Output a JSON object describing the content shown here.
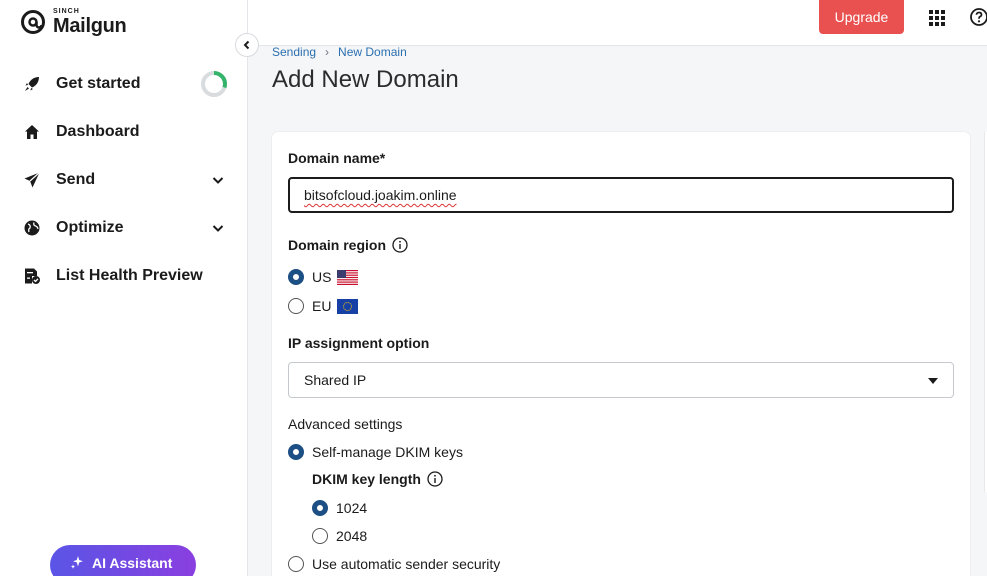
{
  "brand": {
    "small": "SINCH",
    "name": "Mailgun"
  },
  "sidebar": {
    "items": [
      {
        "label": "Get started",
        "icon": "rocket-icon"
      },
      {
        "label": "Dashboard",
        "icon": "home-icon"
      },
      {
        "label": "Send",
        "icon": "paper-plane-icon"
      },
      {
        "label": "Optimize",
        "icon": "globe-icon"
      },
      {
        "label": "List Health Preview",
        "icon": "list-check-icon"
      }
    ],
    "ai_button": "AI Assistant",
    "get_started_progress": 0.3
  },
  "topbar": {
    "upgrade": "Upgrade"
  },
  "breadcrumb": {
    "parent": "Sending",
    "current": "New Domain"
  },
  "page": {
    "title": "Add New Domain"
  },
  "form": {
    "domain_label": "Domain name*",
    "domain_value": "bitsofcloud.joakim.online",
    "region_label": "Domain region",
    "regions": [
      {
        "label": "US",
        "checked": true
      },
      {
        "label": "EU",
        "checked": false
      }
    ],
    "ip_label": "IP assignment option",
    "ip_value": "Shared IP",
    "advanced_label": "Advanced settings",
    "dkim_self_label": "Self-manage DKIM keys",
    "dkim_length_label": "DKIM key length",
    "dkim_lengths": [
      {
        "label": "1024",
        "checked": true
      },
      {
        "label": "2048",
        "checked": false
      }
    ],
    "auto_security_label": "Use automatic sender security"
  },
  "colors": {
    "accent": "#1c4f84",
    "upgrade": "#e95050",
    "link": "#2b6fb0",
    "ai_gradient_start": "#5a55e6",
    "ai_gradient_end": "#8a3fe0"
  }
}
